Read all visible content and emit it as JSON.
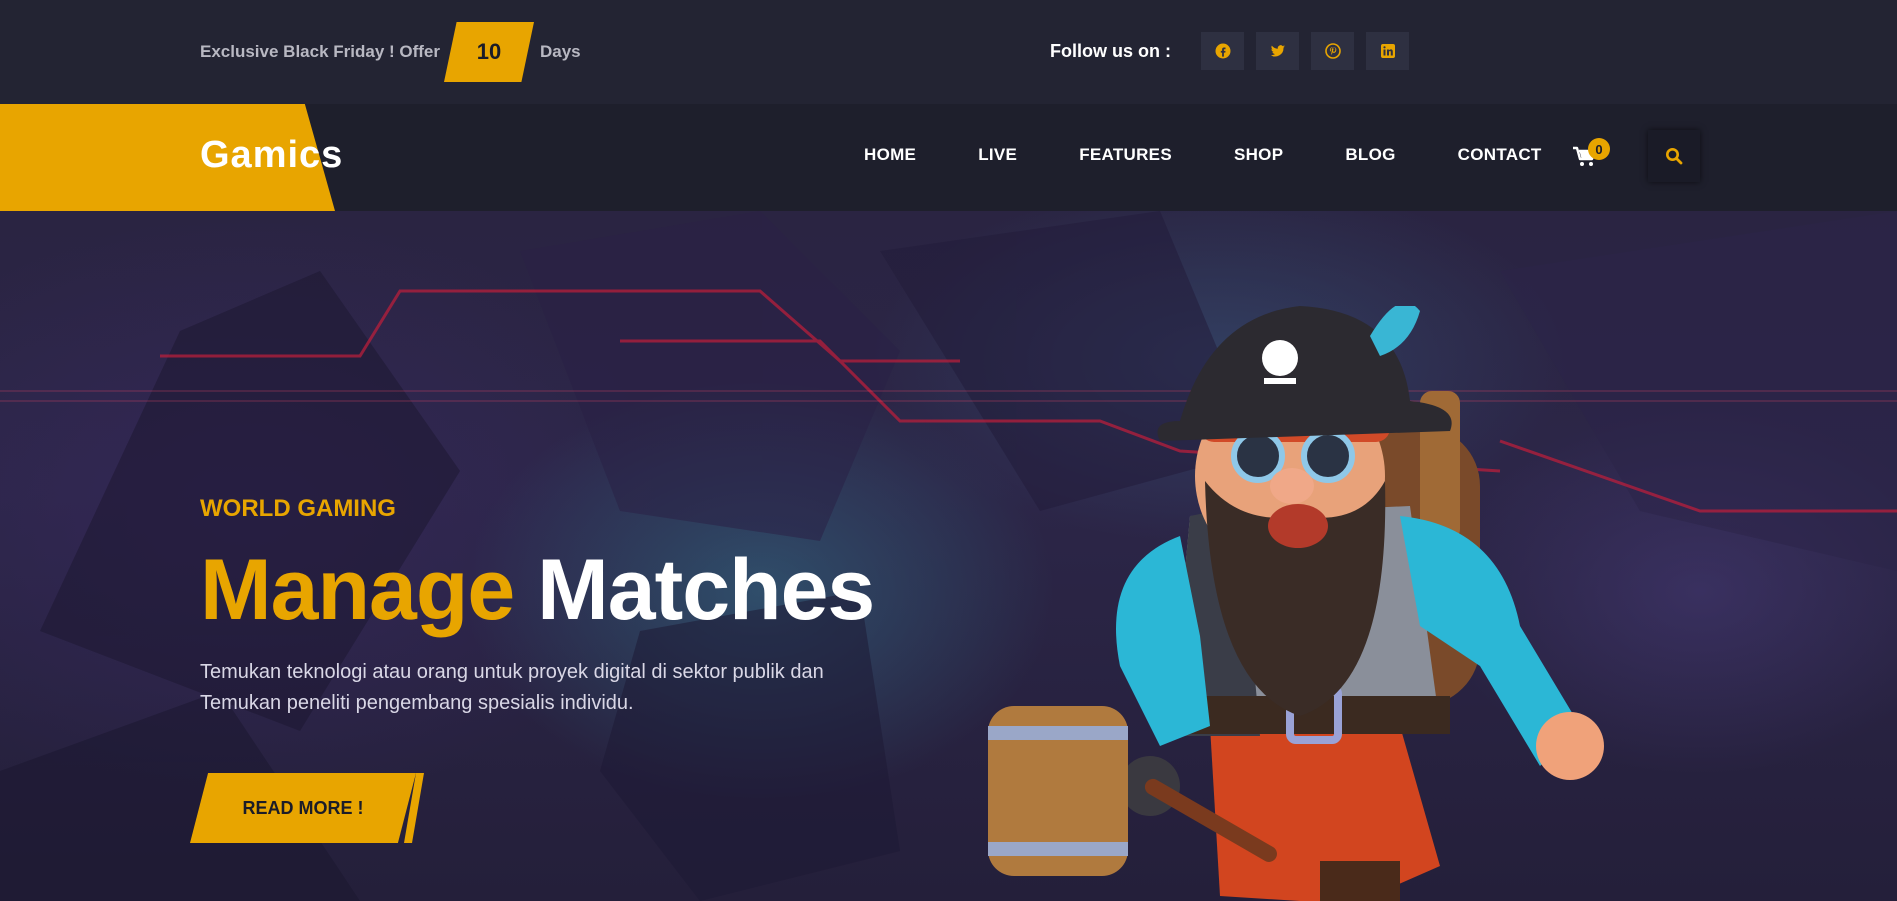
{
  "topbar": {
    "offer_prefix": "Exclusive Black Friday ! Offer",
    "offer_days_count": "10",
    "offer_suffix": "Days",
    "follow_label": "Follow us on :",
    "social": [
      {
        "icon": "facebook-icon"
      },
      {
        "icon": "twitter-icon"
      },
      {
        "icon": "pinterest-icon"
      },
      {
        "icon": "linkedin-icon"
      }
    ]
  },
  "header": {
    "logo": "Gamics",
    "nav": [
      "HOME",
      "LIVE",
      "FEATURES",
      "SHOP",
      "BLOG",
      "CONTACT"
    ],
    "cart_count": "0",
    "search_icon": "search-icon"
  },
  "hero": {
    "kicker": "WORLD GAMING",
    "title_highlight": "Manage",
    "title_rest": "Matches",
    "description_line1": "Temukan teknologi atau orang untuk proyek digital di sektor publik dan",
    "description_line2": "Temukan peneliti pengembang spesialis individu.",
    "button_label": "READ MORE !",
    "image": "pirate-character-illustration"
  },
  "colors": {
    "accent": "#e8a500",
    "topbar_bg": "#232433",
    "header_bg": "#1e1f2c",
    "text_light": "#ffffff"
  }
}
